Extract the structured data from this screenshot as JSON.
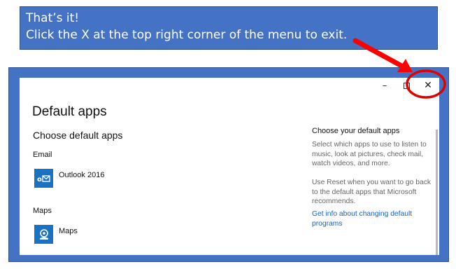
{
  "callout": {
    "line1": "That’s it!",
    "line2": "Click the X at the top right corner of the menu to exit."
  },
  "window": {
    "controls": {
      "minimize": "–",
      "close": "✕"
    },
    "title": "Default apps",
    "subtitle": "Choose default apps",
    "sections": [
      {
        "label": "Email",
        "app": "Outlook 2016",
        "icon": "outlook-icon"
      },
      {
        "label": "Maps",
        "app": "Maps",
        "icon": "maps-icon"
      }
    ],
    "sidebar": {
      "heading": "Choose your default apps",
      "paragraph1": "Select which apps to use to listen to music, look at pictures, check mail, watch videos, and more.",
      "paragraph2": "Use Reset when you want to go back to the default apps that Microsoft recommends.",
      "link": "Get info about changing default programs"
    }
  },
  "annotation": {
    "arrow_color": "#ff0000",
    "circle_color": "#e00000"
  },
  "colors": {
    "frame": "#4472c4",
    "tile": "#1b72c2",
    "link": "#0b63c5"
  }
}
